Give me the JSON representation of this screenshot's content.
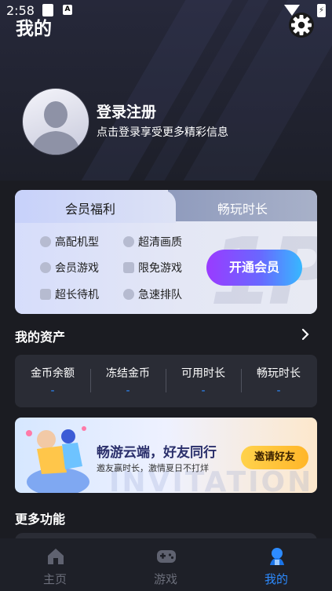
{
  "status_bar": {
    "time": "2:58",
    "notif_icon_b": "A",
    "battery_icon": "bolt-icon"
  },
  "header": {
    "title": "我的",
    "settings_icon": "gear-icon"
  },
  "user": {
    "name": "登录注册",
    "subtitle": "点击登录享受更多精彩信息"
  },
  "vip": {
    "tabs": [
      {
        "label": "会员福利",
        "active": true
      },
      {
        "label": "畅玩时长",
        "active": false
      }
    ],
    "benefits": [
      {
        "label": "高配机型",
        "icon": "clock-icon"
      },
      {
        "label": "超清画质",
        "icon": "plus-icon"
      },
      {
        "label": "会员游戏",
        "icon": "game-icon"
      },
      {
        "label": "限免游戏",
        "icon": "ticket-icon"
      },
      {
        "label": "超长待机",
        "icon": "battery-icon"
      },
      {
        "label": "急速排队",
        "icon": "hd-icon"
      }
    ],
    "watermark": "1P",
    "open_button": "开通会员"
  },
  "assets": {
    "title": "我的资产",
    "items": [
      {
        "label": "金币余额",
        "value": "-"
      },
      {
        "label": "冻结金币",
        "value": "-"
      },
      {
        "label": "可用时长",
        "value": "-"
      },
      {
        "label": "畅玩时长",
        "value": "-"
      }
    ]
  },
  "banner": {
    "title": "畅游云端，好友同行",
    "subtitle": "邀友赢时长，激情夏日不打烊",
    "bg_text": "INVITATION",
    "button": "邀请好友"
  },
  "more": {
    "title": "更多功能"
  },
  "nav": [
    {
      "label": "主页",
      "icon": "home-icon",
      "active": false
    },
    {
      "label": "游戏",
      "icon": "gamepad-icon",
      "active": false
    },
    {
      "label": "我的",
      "icon": "profile-icon",
      "active": true
    }
  ],
  "colors": {
    "accent": "#2d8bff",
    "background": "#1b1c22",
    "card": "#2a2c35"
  }
}
